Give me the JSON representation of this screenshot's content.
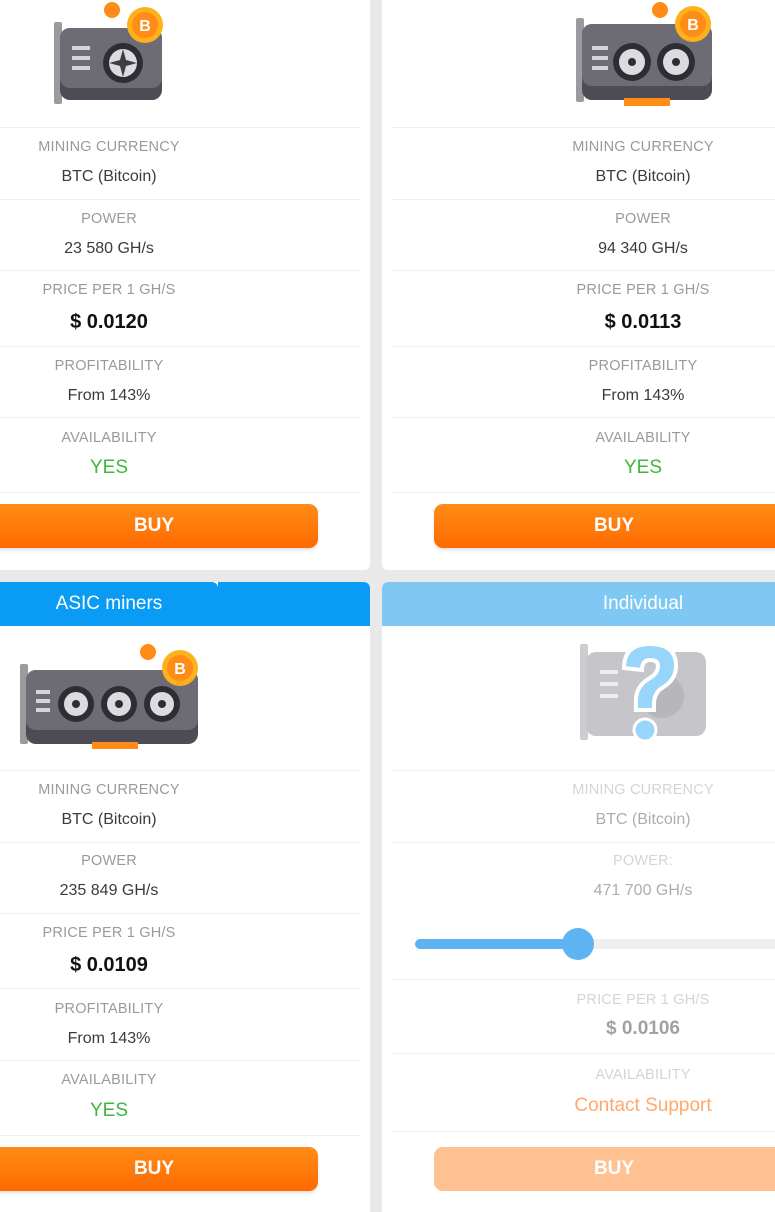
{
  "labels": {
    "mining_currency": "MINING CURRENCY",
    "power": "POWER",
    "power_individual": "POWER:",
    "price_per": "PRICE PER 1 GH/S",
    "profitability": "PROFITABILITY",
    "availability": "AVAILABILITY",
    "buy": "BUY"
  },
  "cards": [
    {
      "currency": "BTC (Bitcoin)",
      "power": "23 580 GH/s",
      "price": "$ 0.0120",
      "profitability": "From 143%",
      "availability": "YES",
      "fans": 1
    },
    {
      "currency": "BTC (Bitcoin)",
      "power": "94 340 GH/s",
      "price": "$ 0.0113",
      "profitability": "From 143%",
      "availability": "YES",
      "fans": 2
    },
    {
      "title": "ASIC miners",
      "currency": "BTC (Bitcoin)",
      "power": "235 849 GH/s",
      "price": "$ 0.0109",
      "profitability": "From 143%",
      "availability": "YES",
      "fans": 3
    },
    {
      "title": "Individual",
      "currency": "BTC (Bitcoin)",
      "power": "471 700 GH/s",
      "price": "$ 0.0106",
      "availability": "Contact Support",
      "slider_fraction": 0.43
    }
  ],
  "colors": {
    "header_blue": "#0a9cf5",
    "header_blue_faded": "#7fc8f3",
    "buy_orange": "#ff7a0a",
    "yes_green": "#3db83c",
    "contact_orange": "#ffa86b"
  }
}
